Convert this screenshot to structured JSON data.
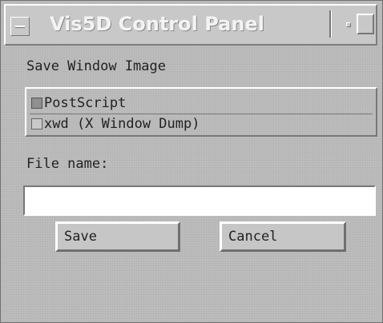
{
  "window": {
    "title": "Vis5D Control Panel"
  },
  "panel": {
    "heading": "Save Window Image",
    "format_options": [
      {
        "label": "PostScript",
        "checked": true
      },
      {
        "label": "xwd (X Window Dump)",
        "checked": false
      }
    ],
    "file_name_label": "File name:",
    "file_name_value": "",
    "save_label": "Save",
    "cancel_label": "Cancel"
  }
}
